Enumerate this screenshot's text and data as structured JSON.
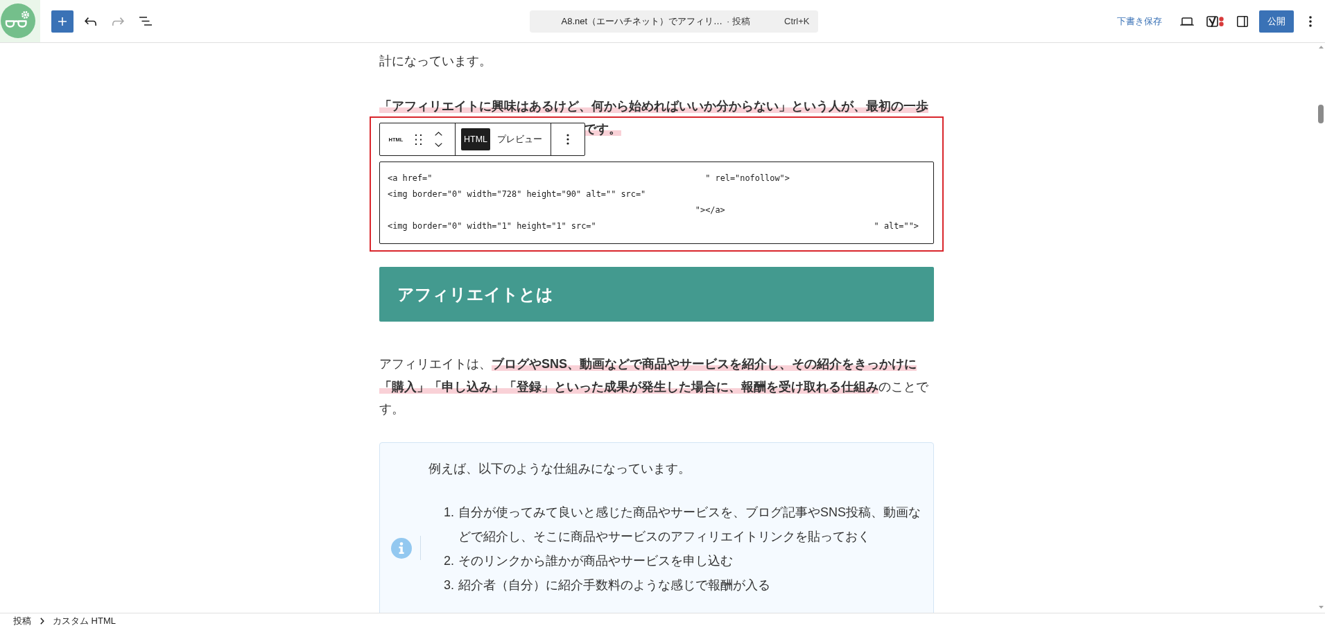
{
  "top_bar": {
    "history": [
      {
        "kind": "undo",
        "disabled": false
      },
      {
        "kind": "redo",
        "disabled": true
      }
    ],
    "command_bar": {
      "title": "A8.net（エーハチネット）でアフィリ…",
      "post_type": "· 投稿",
      "shortcut": "Ctrl+K"
    },
    "save_draft": "下書き保存",
    "publish": "公開"
  },
  "blocks": [
    {
      "kind": "paragraph",
      "selected": false,
      "text": "計になっています。"
    },
    {
      "kind": "marker_lines",
      "selected": false,
      "lines": [
        "「アフィリエイトに興味はあるけど、何から始めればいいか分からない」という人が、最初の一歩",
        "です。"
      ]
    },
    {
      "kind": "html",
      "selected": true,
      "toolbar": {
        "block_icon": "HTML",
        "modes": [
          {
            "label": "HTML",
            "selected": true
          },
          {
            "label": "プレビュー",
            "selected": false
          }
        ]
      },
      "code_lines": [
        [
          "<a href=\"",
          "\" rel=\"nofollow\">"
        ],
        [
          "<img border=\"0\" width=\"728\" height=\"90\" alt=\"\" src=\""
        ],
        [
          "\"></a>"
        ],
        [
          "<img border=\"0\" width=\"1\" height=\"1\" src=\"",
          "\" alt=\"\">"
        ]
      ]
    },
    {
      "kind": "heading",
      "selected": false,
      "text": "アフィリエイトとは"
    },
    {
      "kind": "paragraph",
      "selected": false,
      "text": "アフィリエイトは、**ブログやSNS、動画などで商品やサービスを紹介し、その紹介をきっかけに「購入」「申し込み」「登録」といった成果が発生した場合に、報酬を受け取れる仕組み**のことです。"
    },
    {
      "kind": "info_box",
      "selected": false,
      "intro": "例えば、以下のような仕組みになっています。",
      "items": [
        {
          "number": "1.",
          "text": "自分が使ってみて良いと感じた商品やサービスを、ブログ記事やSNS投稿、動画などで紹介し、そこに商品やサービスのアフィリエイトリンクを貼っておく"
        },
        {
          "number": "2.",
          "text": "そのリンクから誰かが商品やサービスを申し込む"
        },
        {
          "number": "3.",
          "text": "紹介者（自分）に紹介手数料のような感じで報酬が入る"
        }
      ]
    }
  ],
  "breadcrumb": [
    "投稿",
    "カスタム HTML"
  ]
}
